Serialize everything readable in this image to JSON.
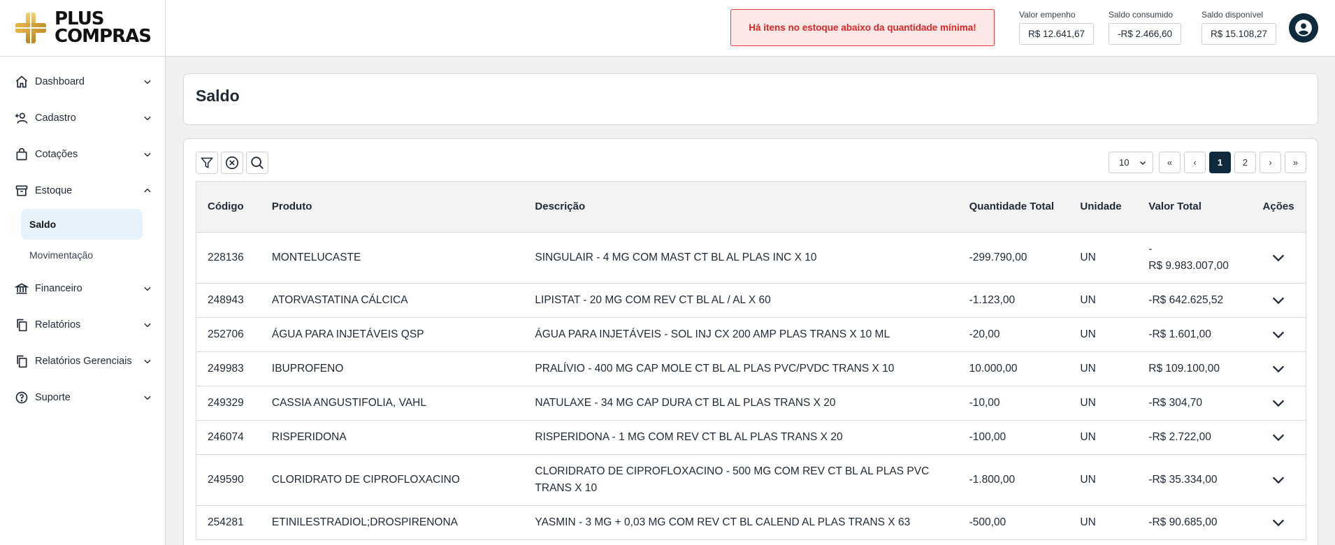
{
  "brand": {
    "line1": "PLUS",
    "line2": "COMPRAS"
  },
  "sidebar": {
    "items": [
      {
        "label": "Dashboard",
        "icon": "home-icon"
      },
      {
        "label": "Cadastro",
        "icon": "user-plus-icon"
      },
      {
        "label": "Cotações",
        "icon": "shopping-bag-icon"
      },
      {
        "label": "Estoque",
        "icon": "archive-box-icon",
        "expanded": true,
        "children": [
          {
            "label": "Saldo",
            "active": true
          },
          {
            "label": "Movimentação"
          }
        ]
      },
      {
        "label": "Financeiro",
        "icon": "bank-icon"
      },
      {
        "label": "Relatórios",
        "icon": "copy-document-icon"
      },
      {
        "label": "Relatórios Gerenciais",
        "icon": "copy-document-icon"
      },
      {
        "label": "Suporte",
        "icon": "help-circle-icon"
      }
    ]
  },
  "header": {
    "alert": "Há itens no estoque abaixo da quantidade mínima!",
    "stats": [
      {
        "label": "Valor empenho",
        "value": "R$ 12.641,67"
      },
      {
        "label": "Saldo consumido",
        "value": "-R$ 2.466,60"
      },
      {
        "label": "Saldo disponível",
        "value": "R$ 15.108,27"
      }
    ],
    "avatar_icon": "user-circle-icon"
  },
  "page": {
    "title": "Saldo"
  },
  "toolbar": {
    "icons": [
      "filter-icon",
      "clear-filter-icon",
      "search-icon"
    ]
  },
  "pagination": {
    "page_size": "10",
    "first": "«",
    "prev": "‹",
    "next": "›",
    "last": "»",
    "pages": [
      "1",
      "2"
    ],
    "current": "1"
  },
  "table": {
    "columns": [
      "Código",
      "Produto",
      "Descrição",
      "Quantidade Total",
      "Unidade",
      "Valor Total",
      "Ações"
    ],
    "rows": [
      {
        "codigo": "228136",
        "produto": "MONTELUCASTE",
        "descricao": "SINGULAIR - 4 MG COM MAST CT BL AL PLAS INC X 10",
        "quantidade": "-299.790,00",
        "unidade": "UN",
        "valor_prefix": "-",
        "valor": "R$ 9.983.007,00"
      },
      {
        "codigo": "248943",
        "produto": "ATORVASTATINA CÁLCICA",
        "descricao": "LIPISTAT - 20 MG COM REV CT BL AL / AL X 60",
        "quantidade": "-1.123,00",
        "unidade": "UN",
        "valor": "-R$ 642.625,52"
      },
      {
        "codigo": "252706",
        "produto": "ÁGUA PARA INJETÁVEIS QSP",
        "descricao": "ÁGUA PARA INJETÁVEIS - SOL INJ CX 200 AMP PLAS TRANS X 10 ML",
        "quantidade": "-20,00",
        "unidade": "UN",
        "valor": "-R$ 1.601,00"
      },
      {
        "codigo": "249983",
        "produto": "IBUPROFENO",
        "descricao": "PRALÍVIO - 400 MG CAP MOLE CT BL AL PLAS PVC/PVDC TRANS X 10",
        "quantidade": "10.000,00",
        "unidade": "UN",
        "valor": "R$ 109.100,00"
      },
      {
        "codigo": "249329",
        "produto": "CASSIA ANGUSTIFOLIA, VAHL",
        "descricao": "NATULAXE - 34 MG CAP DURA CT BL AL PLAS TRANS X 20",
        "quantidade": "-10,00",
        "unidade": "UN",
        "valor": "-R$ 304,70"
      },
      {
        "codigo": "246074",
        "produto": "RISPERIDONA",
        "descricao": "RISPERIDONA - 1 MG COM REV CT BL AL PLAS TRANS X 20",
        "quantidade": "-100,00",
        "unidade": "UN",
        "valor": "-R$ 2.722,00"
      },
      {
        "codigo": "249590",
        "produto": "CLORIDRATO DE CIPROFLOXACINO",
        "descricao": "CLORIDRATO DE CIPROFLOXACINO - 500 MG COM REV CT BL AL PLAS PVC TRANS X 10",
        "quantidade": "-1.800,00",
        "unidade": "UN",
        "valor": "-R$ 35.334,00"
      },
      {
        "codigo": "254281",
        "produto": "ETINILESTRADIOL;DROSPIRENONA",
        "descricao": "YASMIN - 3 MG + 0,03 MG COM REV CT BL CALEND AL PLAS TRANS X 63",
        "quantidade": "-500,00",
        "unidade": "UN",
        "valor": "-R$ 90.685,00"
      }
    ]
  },
  "colors": {
    "accent": "#0f2a3d",
    "alert_bg": "#fde8e8",
    "alert_text": "#e02424",
    "active_sub_bg": "#e6f3fd"
  }
}
